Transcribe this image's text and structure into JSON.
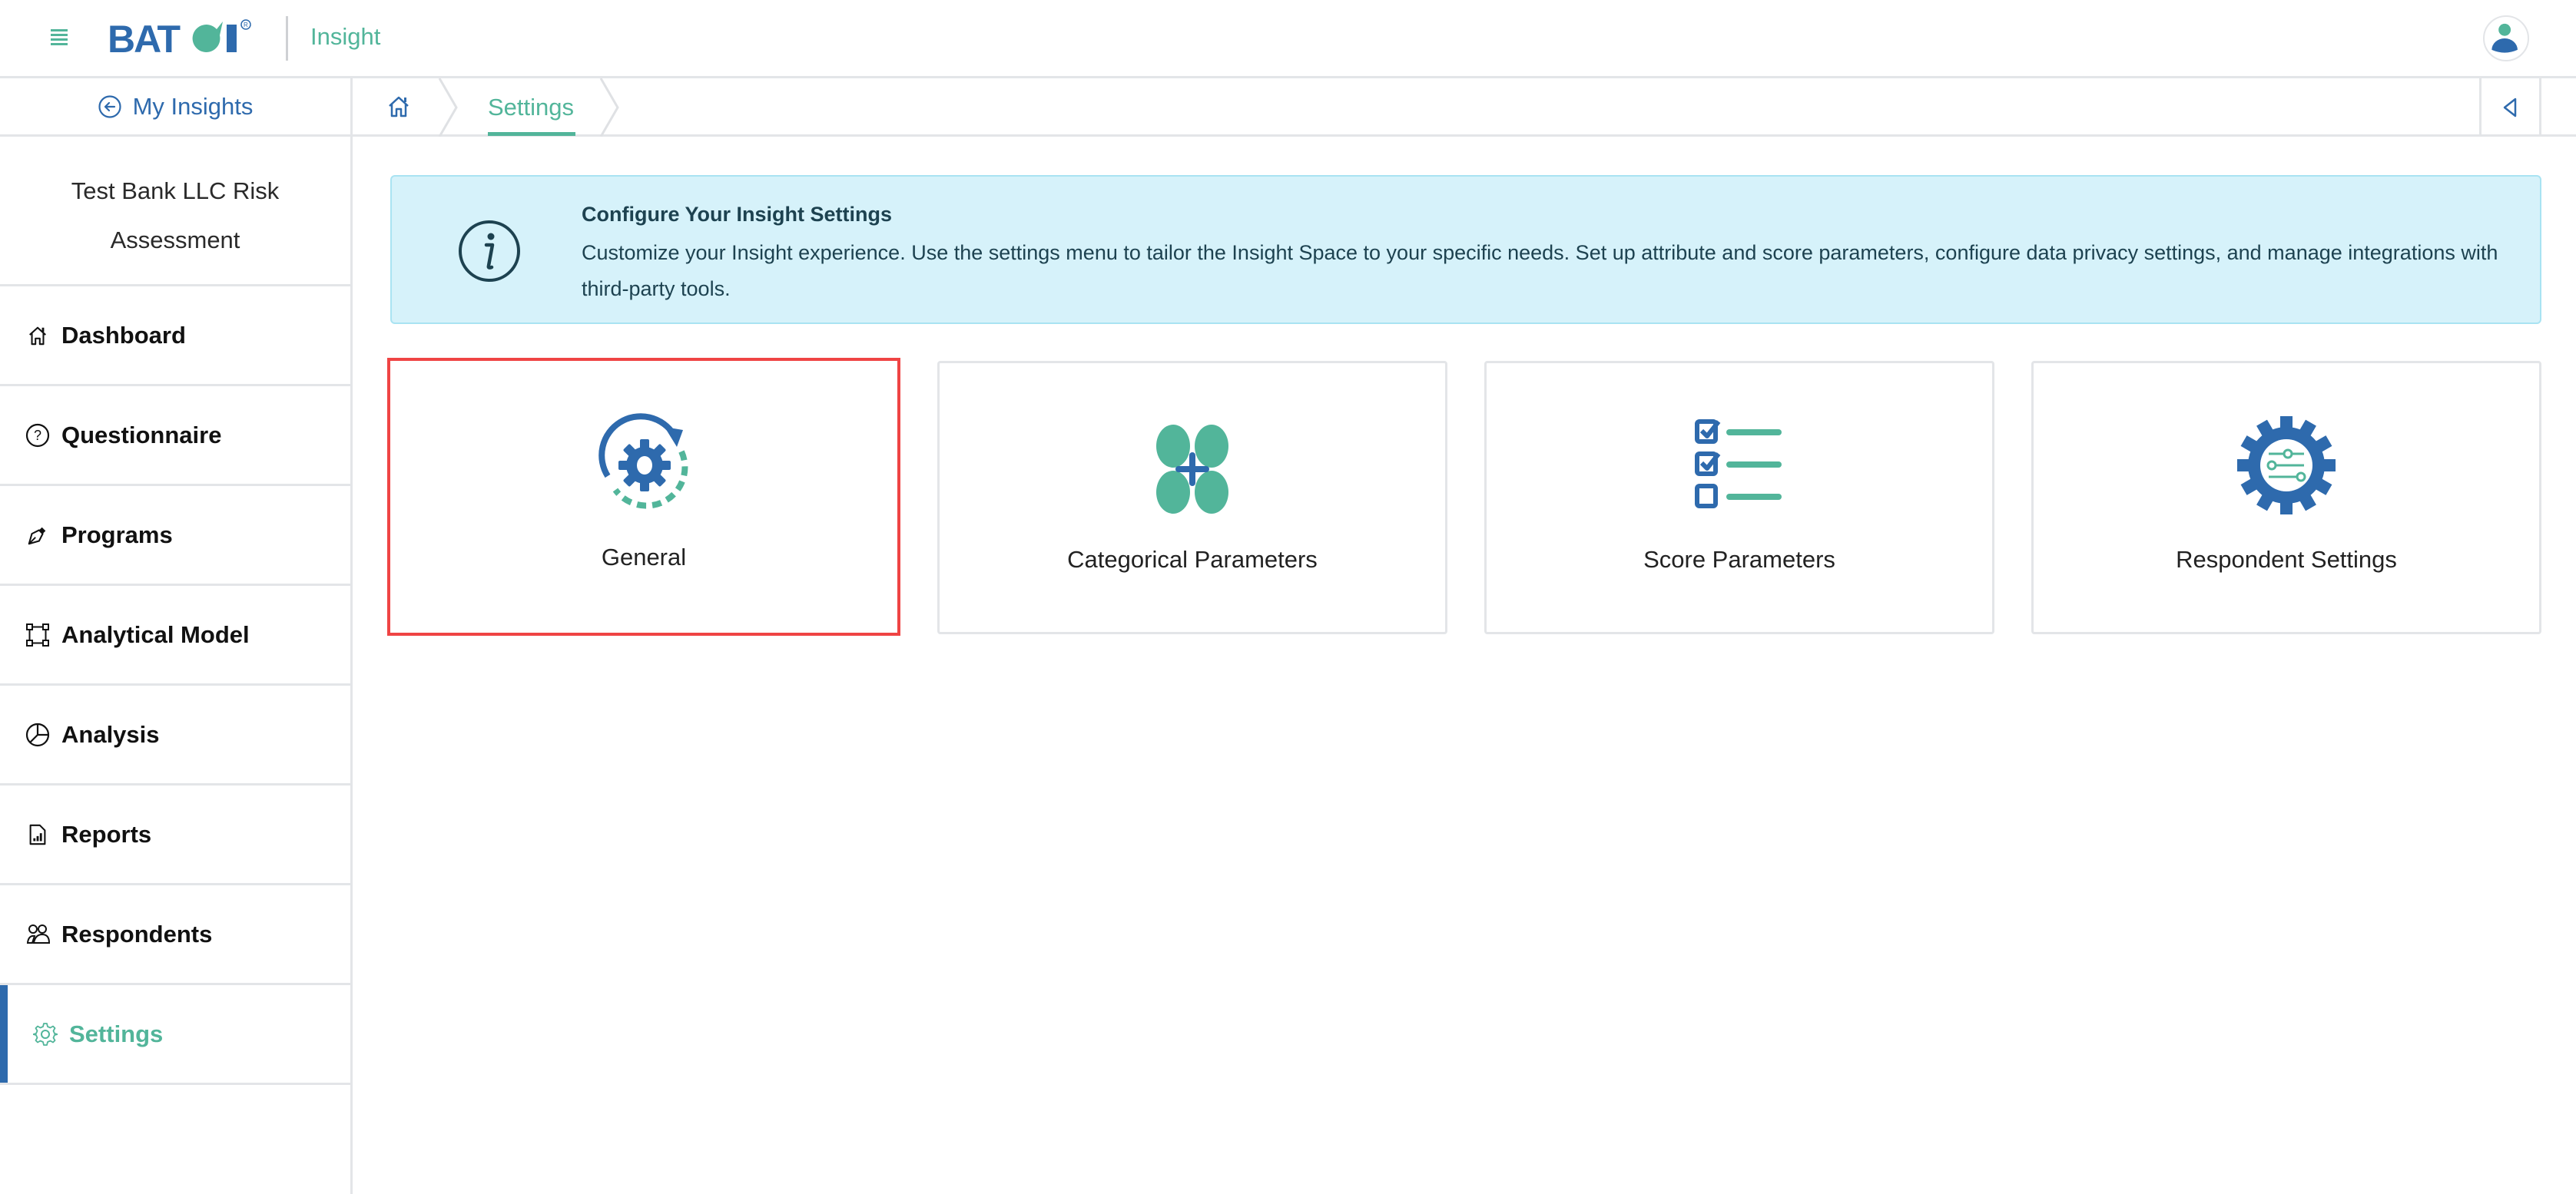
{
  "header": {
    "brand": "BATOI",
    "app_name": "Insight",
    "menu_icon": "hamburger-icon",
    "avatar_icon": "user-avatar-icon"
  },
  "breadcrumb": {
    "home_icon": "home-icon",
    "current": "Settings",
    "collapse_icon": "caret-left-icon"
  },
  "sidebar": {
    "back_label": "My Insights",
    "project_title_line1": "Test Bank LLC Risk",
    "project_title_line2": "Assessment",
    "items": [
      {
        "label": "Dashboard",
        "icon": "home-icon",
        "active": false
      },
      {
        "label": "Questionnaire",
        "icon": "question-circle-icon",
        "active": false
      },
      {
        "label": "Programs",
        "icon": "pen-nib-icon",
        "active": false
      },
      {
        "label": "Analytical Model",
        "icon": "bounding-box-icon",
        "active": false
      },
      {
        "label": "Analysis",
        "icon": "pie-chart-icon",
        "active": false
      },
      {
        "label": "Reports",
        "icon": "file-chart-icon",
        "active": false
      },
      {
        "label": "Respondents",
        "icon": "people-icon",
        "active": false
      },
      {
        "label": "Settings",
        "icon": "gear-icon",
        "active": true
      }
    ]
  },
  "banner": {
    "title": "Configure Your Insight Settings",
    "text": "Customize your Insight experience. Use the settings menu to tailor the Insight Space to your specific needs. Set up attribute and score parameters, configure data privacy settings, and manage integrations with third-party tools."
  },
  "cards": [
    {
      "label": "General",
      "icon": "gear-refresh-icon",
      "selected": true
    },
    {
      "label": "Categorical Parameters",
      "icon": "dots-plus-icon",
      "selected": false
    },
    {
      "label": "Score Parameters",
      "icon": "checklist-icon",
      "selected": false
    },
    {
      "label": "Respondent Settings",
      "icon": "gear-sliders-icon",
      "selected": false
    }
  ],
  "colors": {
    "primary_blue": "#2e6aad",
    "accent_green": "#52b59a",
    "banner_bg": "#d6f2fa",
    "selection_red": "#ef4444",
    "border": "#e3e5e8"
  }
}
